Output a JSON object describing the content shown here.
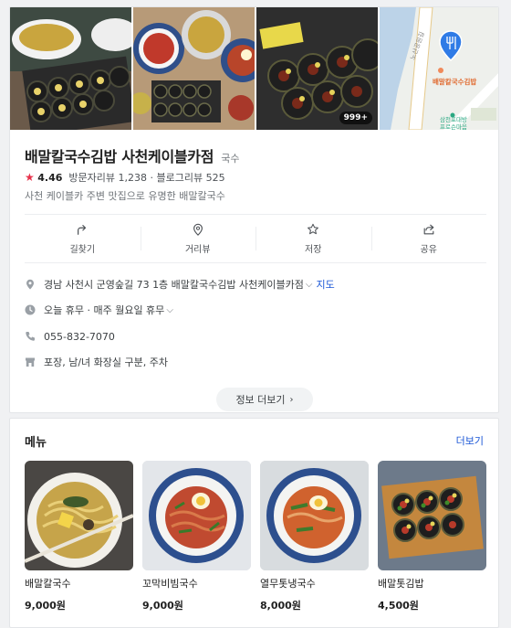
{
  "photos": [
    {
      "name": "noodle-kimbap-photo"
    },
    {
      "name": "table-spread-photo"
    },
    {
      "name": "kimbap-closeup-photo",
      "badge": "999+"
    },
    {
      "name": "map-thumbnail",
      "map_pin_label": "배말칼국수김밥",
      "map_place_label": "삼천포대방\n프로슨마음"
    }
  ],
  "place": {
    "name": "배말칼국수김밥 사천케이블카점",
    "category": "국수",
    "rating": "4.46",
    "visitor_reviews": "방문자리뷰 1,238",
    "separator": "·",
    "blog_reviews": "블로그리뷰 525",
    "description": "사천 케이블카 주변 맛집으로 유명한 배말칼국수"
  },
  "actions": [
    {
      "label": "길찾기",
      "icon": "directions-icon"
    },
    {
      "label": "거리뷰",
      "icon": "street-view-icon"
    },
    {
      "label": "저장",
      "icon": "star-icon"
    },
    {
      "label": "공유",
      "icon": "share-icon"
    }
  ],
  "info": {
    "address": "경남 사천시 군영숲길 73 1층 배말칼국수김밥 사천케이블카점",
    "map_link": "지도",
    "hours": "오늘 휴무 · 매주 월요일 휴무",
    "phone": "055-832-7070",
    "amenities": "포장, 남/녀 화장실 구분, 주차"
  },
  "more_info_label": "정보 더보기",
  "menu": {
    "title": "메뉴",
    "more_label": "더보기",
    "items": [
      {
        "name": "배말칼국수",
        "price": "9,000원"
      },
      {
        "name": "꼬막비빔국수",
        "price": "9,000원"
      },
      {
        "name": "열무톳냉국수",
        "price": "8,000원"
      },
      {
        "name": "배말톳김밥",
        "price": "4,500원"
      }
    ]
  },
  "colors": {
    "star": "#e7324b",
    "link": "#1a56d6",
    "map_pin": "#2f7be6"
  }
}
